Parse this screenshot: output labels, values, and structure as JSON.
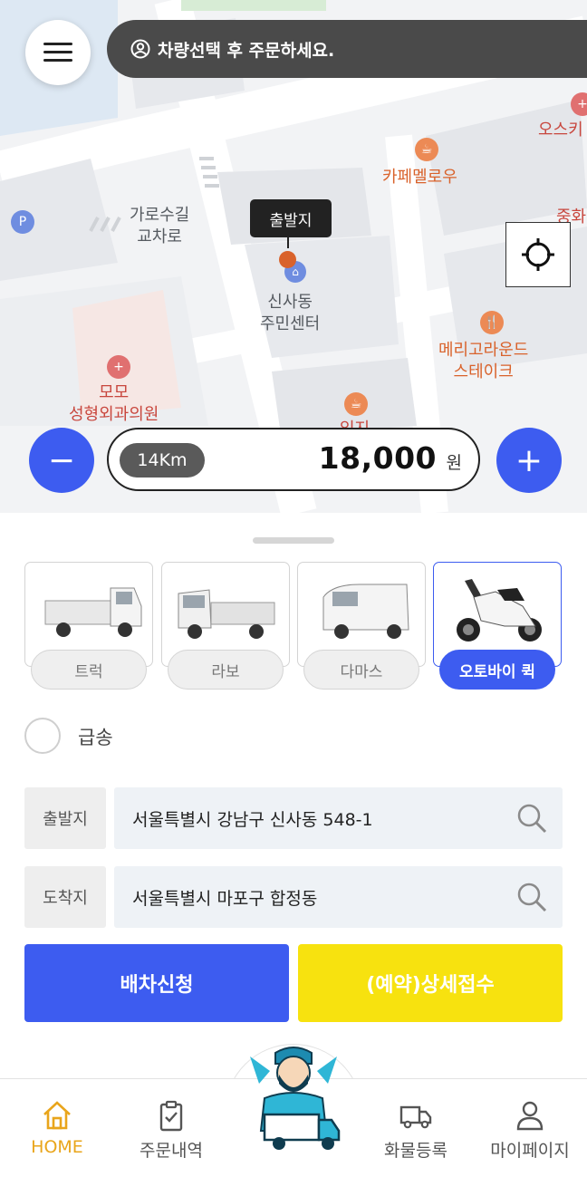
{
  "notice": {
    "text": "차량선택 후 주문하세요."
  },
  "map": {
    "labels": {
      "street": "가로수길\n교차로",
      "garosu_line1": "가로수길",
      "garosu_line2": "교차로",
      "community_line1": "신사동",
      "community_line2": "주민센터",
      "cafe": "카페멜로우",
      "restaurant_line1": "메리고라운드",
      "restaurant_line2": "스테이크",
      "clinic_line1": "모모",
      "clinic_line2": "성형외과의원",
      "top_right": "오스키",
      "right_edge": "중화",
      "cafe2": "있지"
    },
    "origin_tag": "출발지"
  },
  "fare": {
    "distance": "14Km",
    "amount": "18,000",
    "unit": "원"
  },
  "zoom": {
    "out": "−",
    "in": "+"
  },
  "vehicles": [
    {
      "label": "트럭",
      "selected": false
    },
    {
      "label": "라보",
      "selected": false
    },
    {
      "label": "다마스",
      "selected": false
    },
    {
      "label": "오토바이 퀵",
      "selected": true
    }
  ],
  "urgent": {
    "label": "급송",
    "checked": false
  },
  "address": {
    "origin_label": "출발지",
    "origin_value": "서울특별시 강남구 신사동  548-1",
    "destination_label": "도착지",
    "destination_value": "서울특별시 마포구 합정동"
  },
  "actions": {
    "dispatch": "배차신청",
    "reserve": "(예약)상세접수"
  },
  "nav": [
    {
      "label": "HOME",
      "icon": "home-icon",
      "active": true
    },
    {
      "label": "주문내역",
      "icon": "clipboard-check-icon",
      "active": false
    },
    {
      "label": "화물등록",
      "icon": "truck-icon",
      "active": false
    },
    {
      "label": "마이페이지",
      "icon": "person-icon",
      "active": false
    }
  ],
  "colors": {
    "primary": "#3d5cf0",
    "reserve": "#f7e20f",
    "active_nav": "#e9a51b",
    "pin": "#d9622b"
  }
}
